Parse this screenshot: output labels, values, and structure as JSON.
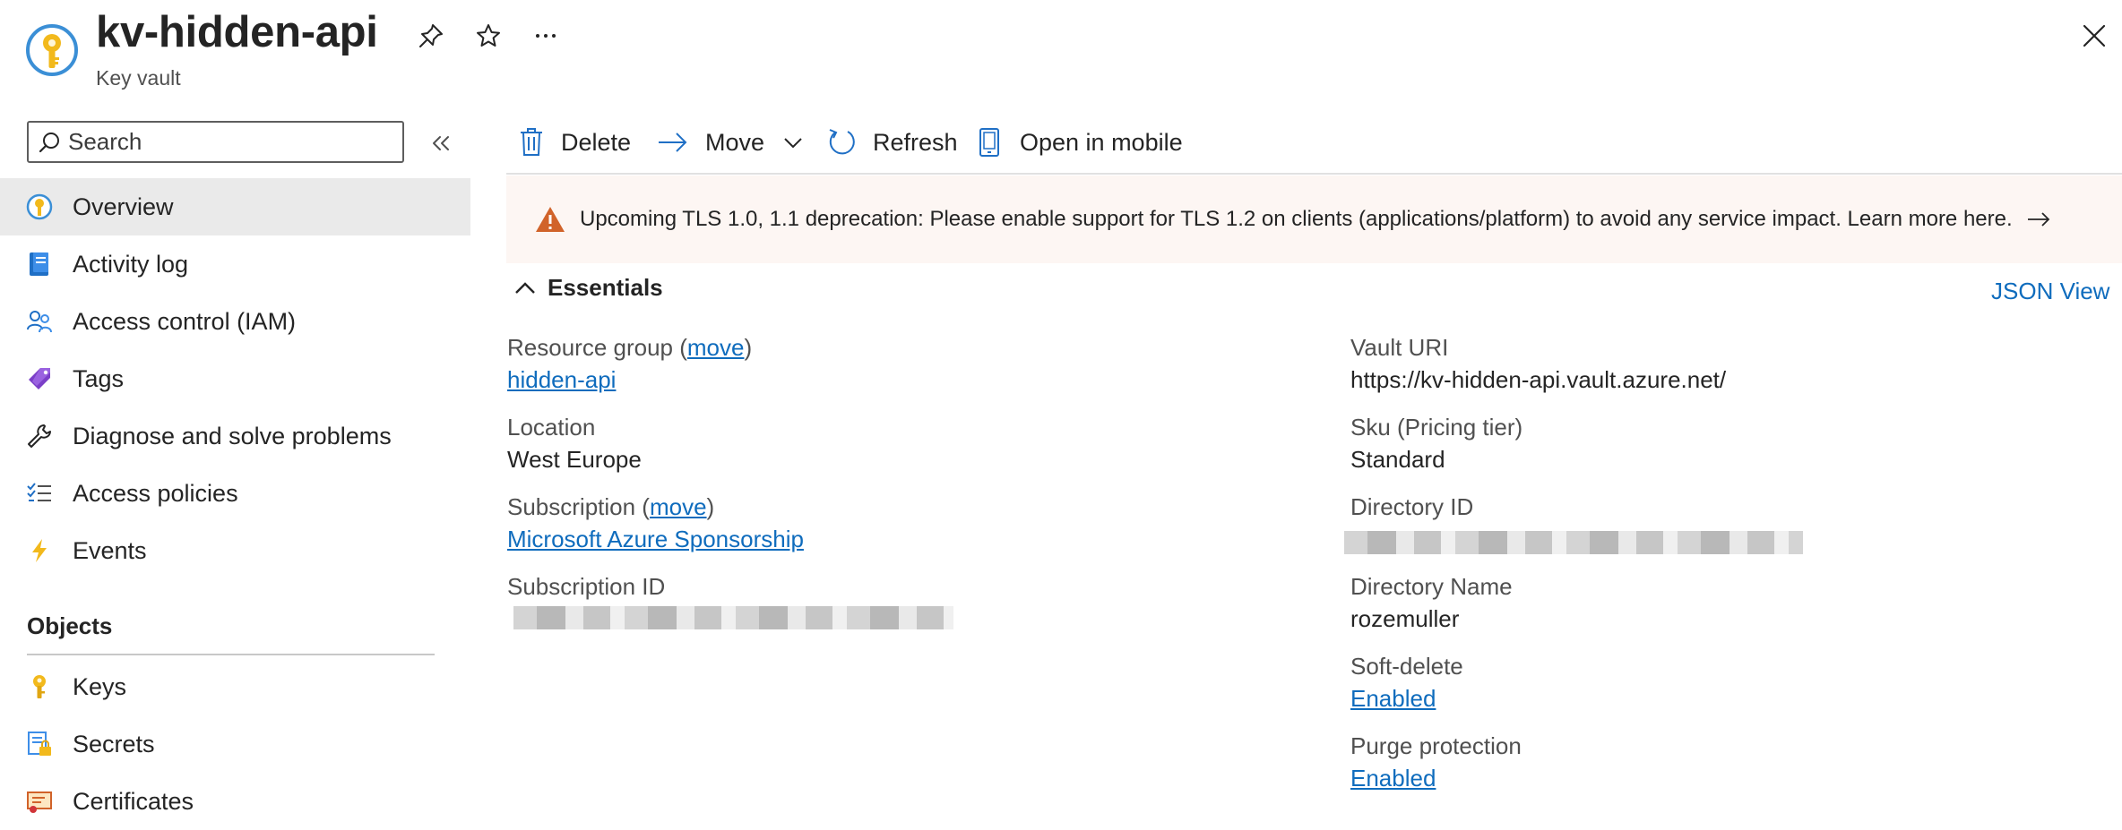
{
  "header": {
    "title": "kv-hidden-api",
    "subtitle": "Key vault",
    "icons": {
      "resource": "key-vault-icon",
      "pin": "pin-icon",
      "favorite": "star-icon",
      "more": "ellipsis-icon",
      "close": "close-icon"
    }
  },
  "sidebar": {
    "search": {
      "placeholder": "Search",
      "value": ""
    },
    "items": [
      {
        "label": "Overview",
        "icon": "key-vault-icon",
        "selected": true
      },
      {
        "label": "Activity log",
        "icon": "activity-log-icon"
      },
      {
        "label": "Access control (IAM)",
        "icon": "people-icon"
      },
      {
        "label": "Tags",
        "icon": "tag-icon"
      },
      {
        "label": "Diagnose and solve problems",
        "icon": "wrench-icon"
      },
      {
        "label": "Access policies",
        "icon": "checklist-icon"
      },
      {
        "label": "Events",
        "icon": "lightning-icon"
      }
    ],
    "objects_heading": "Objects",
    "objects": [
      {
        "label": "Keys",
        "icon": "key-icon"
      },
      {
        "label": "Secrets",
        "icon": "secret-icon"
      },
      {
        "label": "Certificates",
        "icon": "certificate-icon"
      }
    ]
  },
  "command_bar": {
    "delete": "Delete",
    "move": "Move",
    "refresh": "Refresh",
    "open_in_mobile": "Open in mobile"
  },
  "banner": {
    "text": "Upcoming TLS 1.0, 1.1 deprecation: Please enable support for TLS 1.2 on clients (applications/platform) to avoid any service impact. Learn more here.",
    "severity": "warning"
  },
  "essentials": {
    "heading": "Essentials",
    "json_view": "JSON View",
    "move_link": "move",
    "left": {
      "resource_group": {
        "label": "Resource group",
        "value": "hidden-api"
      },
      "location": {
        "label": "Location",
        "value": "West Europe"
      },
      "subscription": {
        "label": "Subscription",
        "value": "Microsoft Azure Sponsorship"
      },
      "subscription_id": {
        "label": "Subscription ID"
      }
    },
    "right": {
      "vault_uri": {
        "label": "Vault URI",
        "value": "https://kv-hidden-api.vault.azure.net/"
      },
      "sku": {
        "label": "Sku (Pricing tier)",
        "value": "Standard"
      },
      "directory_id": {
        "label": "Directory ID"
      },
      "directory_name": {
        "label": "Directory Name",
        "value": "rozemuller"
      },
      "soft_delete": {
        "label": "Soft-delete",
        "value": "Enabled"
      },
      "purge_protection": {
        "label": "Purge protection",
        "value": "Enabled"
      }
    }
  },
  "colors": {
    "link": "#0f6cbd",
    "warning": "#d1632a",
    "banner_bg": "#fdf6f3",
    "selected_bg": "#eaeaea"
  }
}
